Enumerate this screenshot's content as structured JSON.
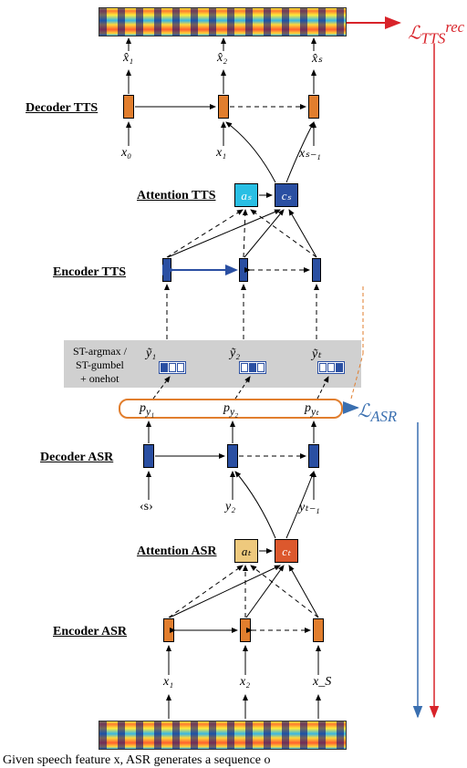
{
  "losses": {
    "tts": "ℒ",
    "tts_sup": "rec",
    "tts_sub": "TTS",
    "asr": "ℒ",
    "asr_sub": "ASR"
  },
  "layers": {
    "decoder_tts": "Decoder TTS",
    "encoder_tts": "Encoder TTS",
    "attention_tts": "Attention TTS",
    "decoder_asr": "Decoder ASR",
    "encoder_asr": "Encoder ASR",
    "attention_asr": "Attention ASR"
  },
  "sampling": {
    "line1": "ST-argmax /",
    "line2": "ST-gumbel",
    "line3": "+ onehot"
  },
  "vars": {
    "xhat": [
      "x̂₁",
      "x̂₂",
      "x̂ₛ"
    ],
    "xin": [
      "x₀",
      "x₁",
      "xₛ₋₁"
    ],
    "att_tts": [
      "aₛ",
      "cₛ"
    ],
    "ytilde": [
      "ỹ₁",
      "ỹ₂",
      "ỹₜ"
    ],
    "py": [
      "p_{y₁}",
      "p_{y₂}",
      "p_{yₜ}"
    ],
    "yin": [
      "‹s›",
      "y₂",
      "yₜ₋₁"
    ],
    "att_asr": [
      "aₜ",
      "cₜ"
    ],
    "xbottom": [
      "x₁",
      "x₂",
      "x_S"
    ]
  },
  "caption": "Given speech feature x, ASR generates a sequence o"
}
